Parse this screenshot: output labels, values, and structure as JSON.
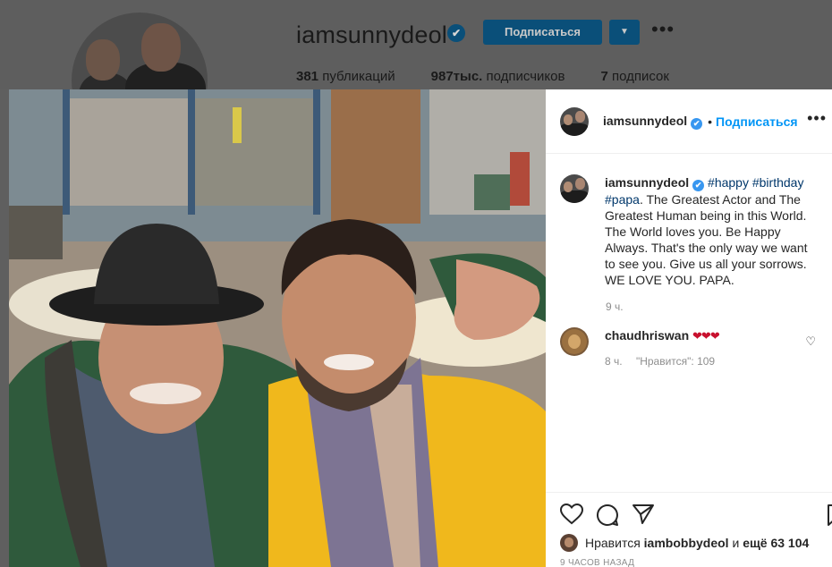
{
  "profile": {
    "username": "iamsunnydeol",
    "verified_icon": "✔",
    "follow_label": "Подписаться",
    "dropdown_icon": "▼",
    "more_icon": "•••",
    "stats": [
      {
        "count": "381",
        "label": "публикаций"
      },
      {
        "count": "987тыс.",
        "label": "подписчиков"
      },
      {
        "count": "7",
        "label": "подписок"
      }
    ]
  },
  "post": {
    "header": {
      "username": "iamsunnydeol",
      "verified_icon": "✔",
      "separator": "•",
      "follow_label": "Подписаться",
      "more_icon": "•••"
    },
    "caption": {
      "username": "iamsunnydeol",
      "verified_icon": "✔",
      "hashtags": "#happy #birthday #papa",
      "text": ". The Greatest Actor and The Greatest Human being in this World. The World loves you. Be Happy Always. That's the only way we want to see you. Give us all your sorrows. WE LOVE YOU. PAPA.",
      "time": "9 ч."
    },
    "comments": [
      {
        "username": "chaudhriswan",
        "text": "❤❤❤",
        "time": "8 ч.",
        "likes": "\"Нравится\": 109",
        "like_icon": "♡"
      }
    ],
    "likes": {
      "prefix": "Нравится",
      "user": "iambobbydeol",
      "conjunction": "и",
      "others": "ещё 63 104"
    },
    "time_ago": "9 ЧАСОВ НАЗАД"
  },
  "colors": {
    "accent": "#0095f6",
    "hashtag": "#00376b",
    "heart": "#c8102e",
    "muted": "#8e8e8e"
  }
}
